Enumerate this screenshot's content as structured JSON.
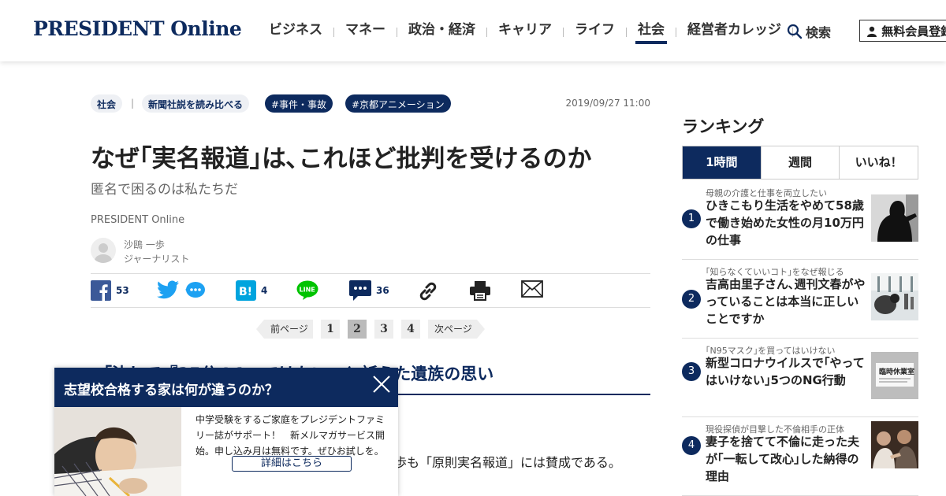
{
  "header": {
    "logo": "PRESIDENT Online",
    "nav": [
      "ビジネス",
      "マネー",
      "政治・経済",
      "キャリア",
      "ライフ",
      "社会",
      "経営者カレッジ"
    ],
    "active_nav": "社会",
    "search_label": "検索",
    "member_label": "無料会員登録"
  },
  "article": {
    "tags": {
      "category": "社会",
      "series": "新聞社説を読み比べる",
      "hashtag1": "#事件・事故",
      "hashtag2": "#京都アニメーション"
    },
    "date": "2019/09/27 11:00",
    "title": "なぜ｢実名報道｣は､これほど批判を受けるのか",
    "subtitle": "匿名で困るのは私たちだ",
    "source": "PRESIDENT Online",
    "author_name": "沙鴎 一歩",
    "author_role": "ジャーナリスト",
    "share_counts": {
      "facebook": "53",
      "hatena": "4",
      "comments": "36"
    },
    "pager": {
      "prev": "前ページ",
      "next": "次ページ",
      "pages": [
        "1",
        "2",
        "3",
        "4"
      ],
      "current": "2"
    },
    "section_heading": "「決して『25分の1』ではない」と訴えた遺族の思い",
    "body_text": "歩も「原則実名報道」には賛成である。"
  },
  "popup": {
    "title": "志望校合格する家は何が違うのか？",
    "text": "中学受験をするご家庭をプレジデントファミリー誌がサポート！　新メルマガサービス開始。申し込み月は無料です。ぜひお試しを。",
    "button": "詳細はこちら"
  },
  "ranking": {
    "title": "ランキング",
    "tabs": [
      "1時間",
      "週間",
      "いいね！"
    ],
    "active_tab": "1時間",
    "items": [
      {
        "rank": "1",
        "kicker": "母親の介護と仕事を両立したい",
        "title": "ひきこもり生活をやめて58歳で働き始めた女性の月10万円の仕事"
      },
      {
        "rank": "2",
        "kicker": "｢知らなくていいコト｣をなぜ報じる",
        "title": "吉高由里子さん､週刊文春がやっていることは本当に正しいことですか"
      },
      {
        "rank": "3",
        "kicker": "｢N95マスク｣を買ってはいけない",
        "title": "新型コロナウイルスで｢やってはいけない｣5つのNG行動"
      },
      {
        "rank": "4",
        "kicker": "現役探偵が目撃した不倫相手の正体",
        "title": "妻子を捨てて不倫に走った夫が｢一転して改心｣した納得の理由"
      }
    ],
    "thumb3_sign": "臨時休業室"
  },
  "colors": {
    "brand_navy": "#0d2a5e",
    "facebook": "#3b5998",
    "twitter": "#1da1f2",
    "hatena": "#00a4de",
    "line": "#00c300"
  }
}
